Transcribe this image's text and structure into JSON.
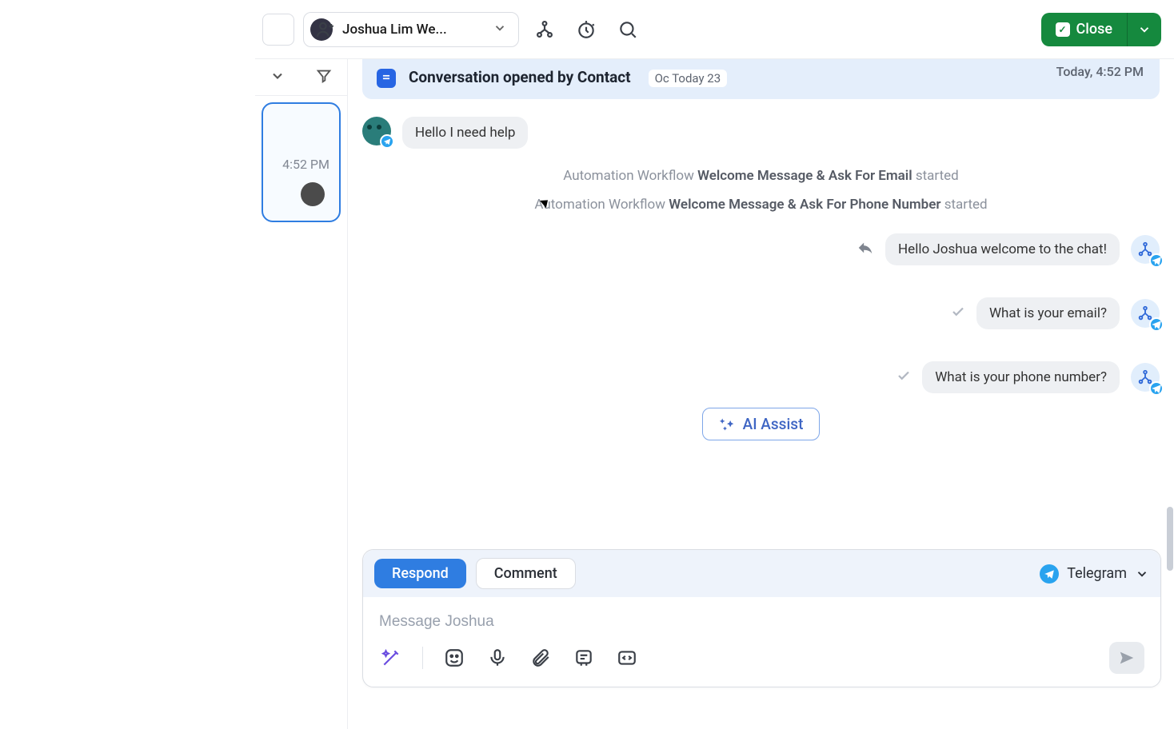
{
  "left": {
    "conv_time": "4:52 PM"
  },
  "header": {
    "contact_name": "Joshua Lim We...",
    "close_label": "Close"
  },
  "banner": {
    "title": "Conversation opened by Contact",
    "date_pill": "Oc Today 23",
    "timestamp": "Today, 4:52 PM"
  },
  "workflows": {
    "prefix": "Automation Workflow",
    "suffix": "started",
    "one": "Welcome Message & Ask For Email",
    "two": "Welcome Message & Ask For Phone Number"
  },
  "messages": {
    "in1": "Hello I need help",
    "out1": "Hello Joshua welcome to the chat!",
    "out2": "What is your email?",
    "out3": "What is your phone number?"
  },
  "ai_assist": "AI Assist",
  "composer": {
    "respond": "Respond",
    "comment": "Comment",
    "channel": "Telegram",
    "placeholder": "Message Joshua"
  }
}
